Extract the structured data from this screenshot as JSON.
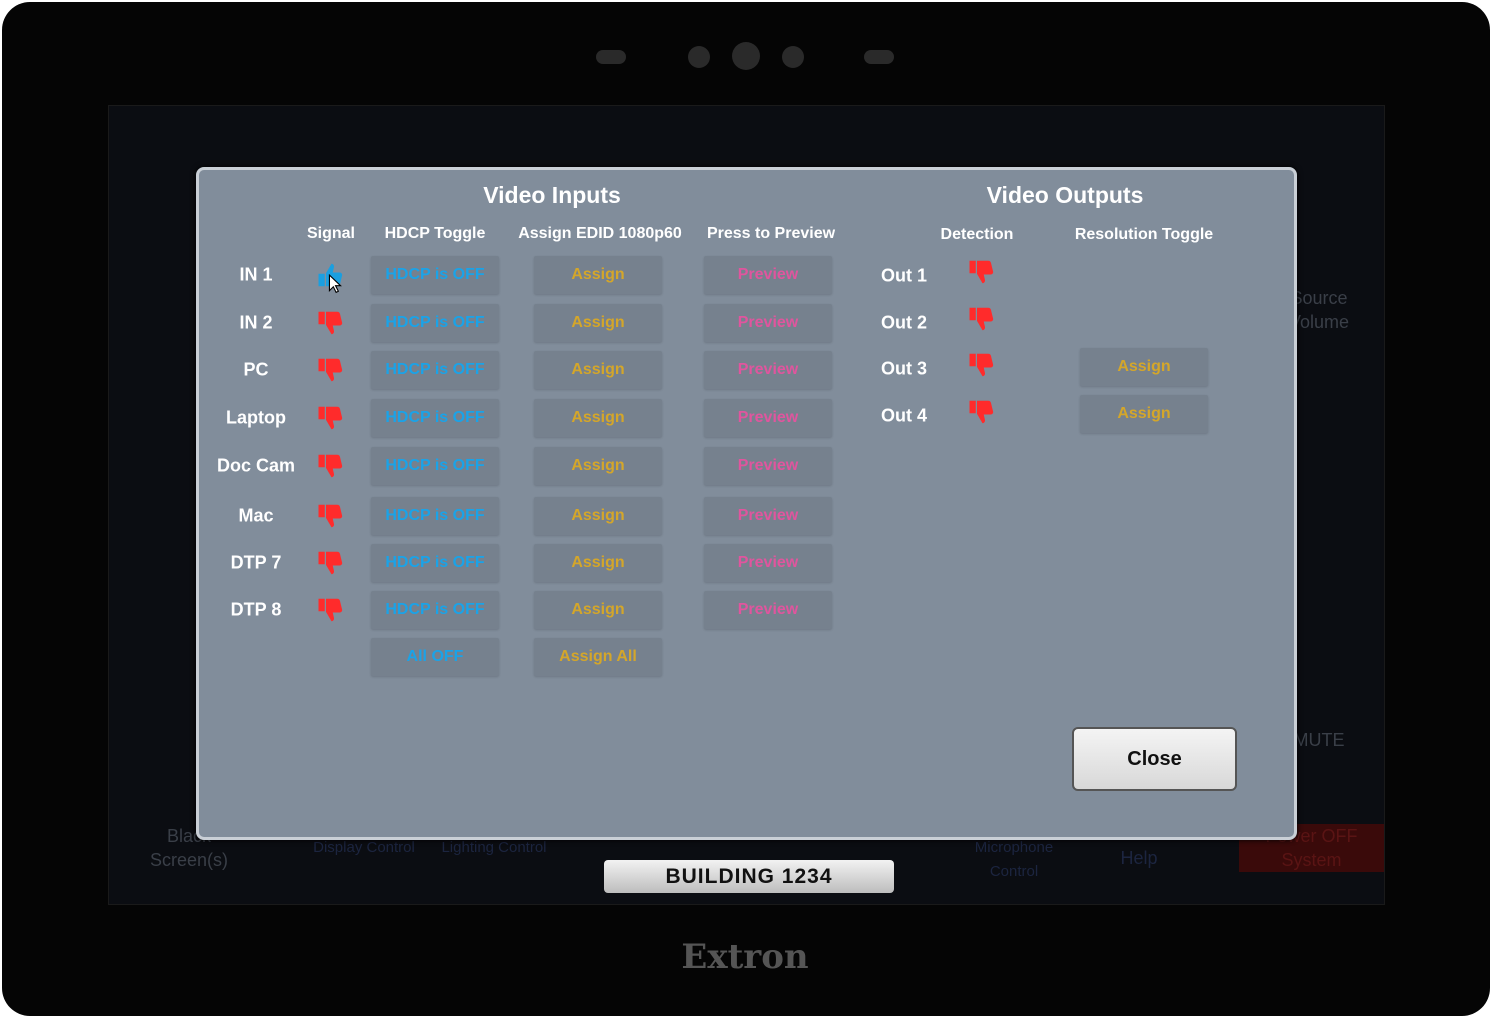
{
  "background": {
    "buttons": [
      "Black Screen(s)",
      "Display Control",
      "Lighting Control",
      "Microphone Control",
      "Help",
      "Power OFF System"
    ],
    "side_labels": [
      "Source Volume",
      "MUTE"
    ]
  },
  "modal": {
    "inputs_title": "Video Inputs",
    "outputs_title": "Video Outputs",
    "input_headers": {
      "signal": "Signal",
      "hdcp": "HDCP Toggle",
      "edid": "Assign EDID 1080p60",
      "preview": "Press to Preview"
    },
    "output_headers": {
      "detection": "Detection",
      "resolution": "Resolution Toggle"
    },
    "inputs": [
      {
        "name": "IN 1",
        "signal": "thumbs-up",
        "hdcp": "HDCP is OFF",
        "assign": "Assign",
        "preview": "Preview"
      },
      {
        "name": "IN 2",
        "signal": "thumbs-down",
        "hdcp": "HDCP is OFF",
        "assign": "Assign",
        "preview": "Preview"
      },
      {
        "name": "PC",
        "signal": "thumbs-down",
        "hdcp": "HDCP is OFF",
        "assign": "Assign",
        "preview": "Preview"
      },
      {
        "name": "Laptop",
        "signal": "thumbs-down",
        "hdcp": "HDCP is OFF",
        "assign": "Assign",
        "preview": "Preview"
      },
      {
        "name": "Doc Cam",
        "signal": "thumbs-down",
        "hdcp": "HDCP is OFF",
        "assign": "Assign",
        "preview": "Preview"
      },
      {
        "name": "Mac",
        "signal": "thumbs-down",
        "hdcp": "HDCP is OFF",
        "assign": "Assign",
        "preview": "Preview"
      },
      {
        "name": "DTP 7",
        "signal": "thumbs-down",
        "hdcp": "HDCP is OFF",
        "assign": "Assign",
        "preview": "Preview"
      },
      {
        "name": "DTP 8",
        "signal": "thumbs-down",
        "hdcp": "HDCP is OFF",
        "assign": "Assign",
        "preview": "Preview"
      }
    ],
    "all_off": "All OFF",
    "assign_all": "Assign All",
    "outputs": [
      {
        "name": "Out 1",
        "detection": "thumbs-down",
        "resolution": null
      },
      {
        "name": "Out 2",
        "detection": "thumbs-down",
        "resolution": null
      },
      {
        "name": "Out 3",
        "detection": "thumbs-down",
        "resolution": "Assign"
      },
      {
        "name": "Out 4",
        "detection": "thumbs-down",
        "resolution": "Assign"
      }
    ],
    "close": "Close"
  },
  "footer_label": "BUILDING 1234",
  "brand": "Extron",
  "colors": {
    "hdcp": "#1aa3e8",
    "assign": "#d4a62a",
    "preview": "#e0559e",
    "thumbs_down": "#ff2b2b",
    "thumbs_up": "#1a9fe0",
    "modal_bg": "#818d9b"
  }
}
